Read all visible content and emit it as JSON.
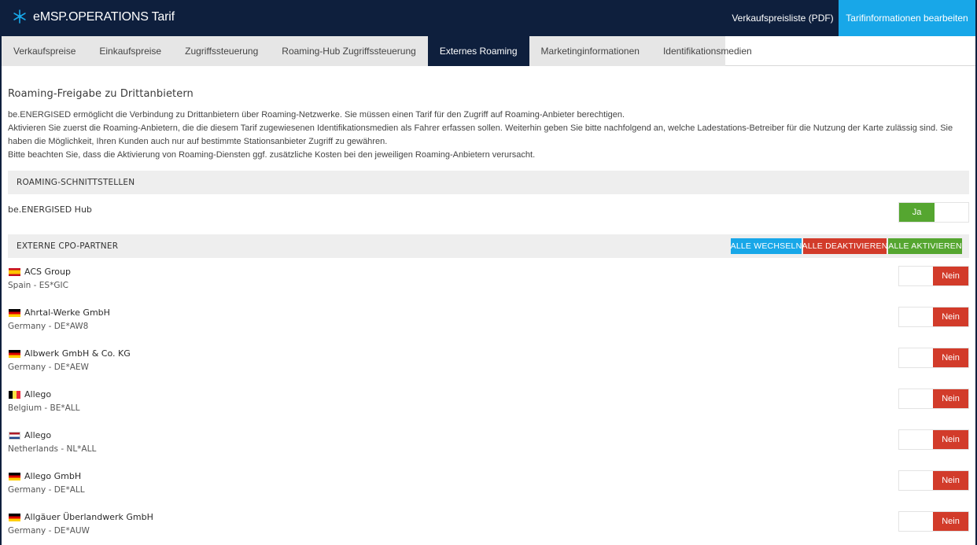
{
  "header": {
    "title": "eMSP.OPERATIONS Tarif",
    "pdf_label": "Verkaufspreisliste (PDF)",
    "edit_label": "Tarifinformationen bearbeiten"
  },
  "tabs": [
    {
      "label": "Verkaufspreise"
    },
    {
      "label": "Einkaufspreise"
    },
    {
      "label": "Zugriffssteuerung"
    },
    {
      "label": "Roaming-Hub Zugriffssteuerung"
    },
    {
      "label": "Externes Roaming"
    },
    {
      "label": "Marketinginformationen"
    },
    {
      "label": "Identifikationsmedien"
    }
  ],
  "active_tab": "Externes Roaming",
  "main": {
    "section_title": "Roaming-Freigabe zu Drittanbietern",
    "desc": [
      "be.ENERGISED ermöglicht die Verbindung zu Drittanbietern über Roaming-Netzwerke. Sie müssen einen Tarif für den Zugriff auf Roaming-Anbieter berechtigen.",
      "Aktivieren Sie zuerst die Roaming-Anbietern, die die diesem Tarif zugewiesenen Identifikationsmedien als Fahrer erfassen sollen. Weiterhin geben Sie bitte nachfolgend an, welche Ladestations-Betreiber für die Nutzung der Karte zulässig sind. Sie haben die Möglichkeit, Ihren Kunden auch nur auf bestimmte Stationsanbieter Zugriff zu gewähren.",
      "Bitte beachten Sie, dass die Aktivierung von Roaming-Diensten ggf. zusätzliche Kosten bei den jeweiligen Roaming-Anbietern verursacht."
    ],
    "interfaces_header": "ROAMING-SCHNITTSTELLEN",
    "hub": {
      "label": "be.ENERGISED Hub",
      "toggle": "Ja",
      "enabled": true
    },
    "cpo_header": "EXTERNE CPO-PARTNER",
    "bulk": {
      "toggle_all": "ALLE WECHSELN",
      "deactivate_all": "ALLE DEAKTIVIEREN",
      "activate_all": "ALLE AKTIVIEREN"
    },
    "partners": [
      {
        "name": "ACS Group",
        "meta": "Spain - ES*GIC",
        "flag": "es",
        "toggle": "Nein",
        "enabled": false
      },
      {
        "name": "Ahrtal-Werke GmbH",
        "meta": "Germany - DE*AW8",
        "flag": "de",
        "toggle": "Nein",
        "enabled": false
      },
      {
        "name": "Albwerk GmbH & Co. KG",
        "meta": "Germany - DE*AEW",
        "flag": "de",
        "toggle": "Nein",
        "enabled": false
      },
      {
        "name": "Allego",
        "meta": "Belgium - BE*ALL",
        "flag": "be",
        "toggle": "Nein",
        "enabled": false
      },
      {
        "name": "Allego",
        "meta": "Netherlands - NL*ALL",
        "flag": "nl",
        "toggle": "Nein",
        "enabled": false
      },
      {
        "name": "Allego GmbH",
        "meta": "Germany - DE*ALL",
        "flag": "de",
        "toggle": "Nein",
        "enabled": false
      },
      {
        "name": "Allgäuer Überlandwerk GmbH",
        "meta": "Germany - DE*AUW",
        "flag": "de",
        "toggle": "Nein",
        "enabled": false
      }
    ]
  },
  "colors": {
    "navy": "#0e1f3d",
    "accent_blue": "#18a7e8",
    "green": "#55a630",
    "red": "#d23b2a"
  }
}
